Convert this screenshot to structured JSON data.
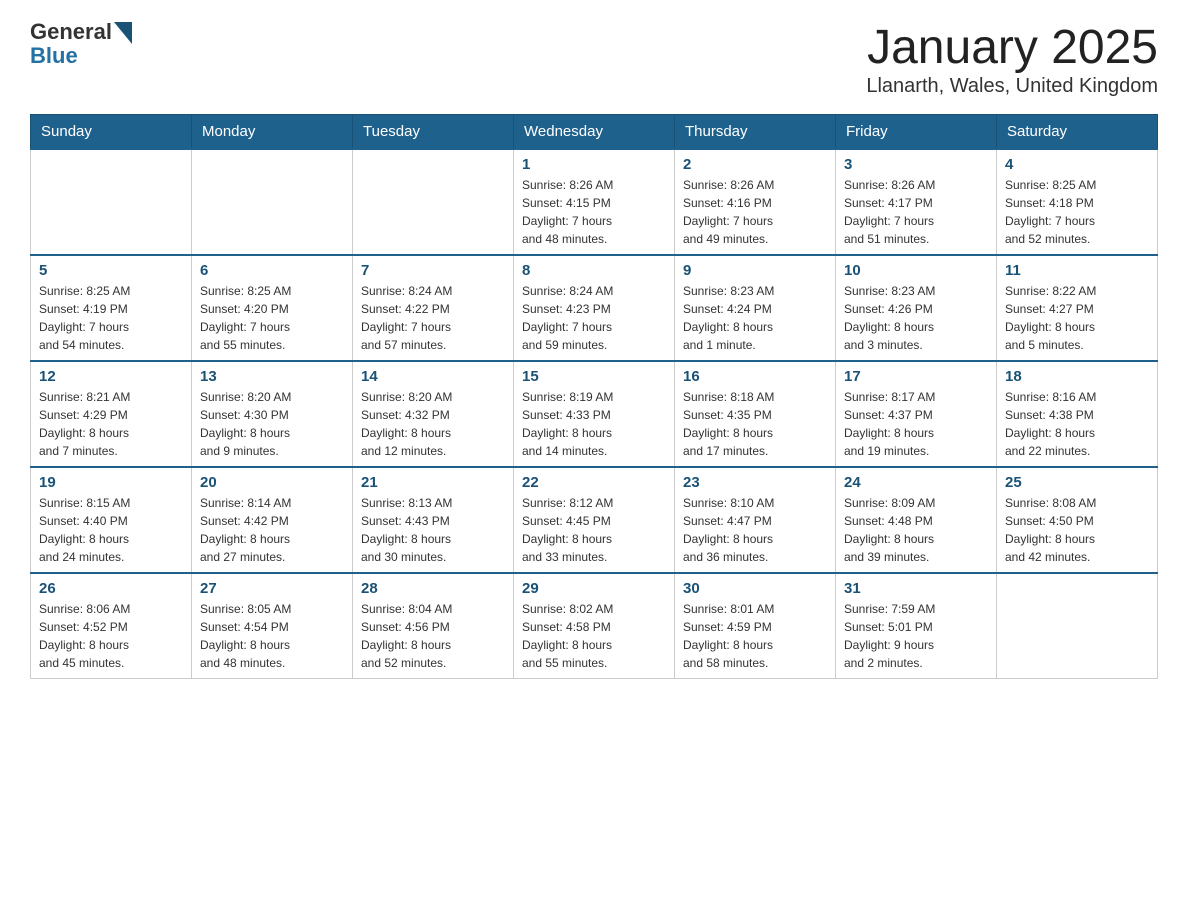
{
  "header": {
    "logo_general": "General",
    "logo_blue": "Blue",
    "month_title": "January 2025",
    "location": "Llanarth, Wales, United Kingdom"
  },
  "days_of_week": [
    "Sunday",
    "Monday",
    "Tuesday",
    "Wednesday",
    "Thursday",
    "Friday",
    "Saturday"
  ],
  "weeks": [
    [
      {
        "day": "",
        "info": ""
      },
      {
        "day": "",
        "info": ""
      },
      {
        "day": "",
        "info": ""
      },
      {
        "day": "1",
        "info": "Sunrise: 8:26 AM\nSunset: 4:15 PM\nDaylight: 7 hours\nand 48 minutes."
      },
      {
        "day": "2",
        "info": "Sunrise: 8:26 AM\nSunset: 4:16 PM\nDaylight: 7 hours\nand 49 minutes."
      },
      {
        "day": "3",
        "info": "Sunrise: 8:26 AM\nSunset: 4:17 PM\nDaylight: 7 hours\nand 51 minutes."
      },
      {
        "day": "4",
        "info": "Sunrise: 8:25 AM\nSunset: 4:18 PM\nDaylight: 7 hours\nand 52 minutes."
      }
    ],
    [
      {
        "day": "5",
        "info": "Sunrise: 8:25 AM\nSunset: 4:19 PM\nDaylight: 7 hours\nand 54 minutes."
      },
      {
        "day": "6",
        "info": "Sunrise: 8:25 AM\nSunset: 4:20 PM\nDaylight: 7 hours\nand 55 minutes."
      },
      {
        "day": "7",
        "info": "Sunrise: 8:24 AM\nSunset: 4:22 PM\nDaylight: 7 hours\nand 57 minutes."
      },
      {
        "day": "8",
        "info": "Sunrise: 8:24 AM\nSunset: 4:23 PM\nDaylight: 7 hours\nand 59 minutes."
      },
      {
        "day": "9",
        "info": "Sunrise: 8:23 AM\nSunset: 4:24 PM\nDaylight: 8 hours\nand 1 minute."
      },
      {
        "day": "10",
        "info": "Sunrise: 8:23 AM\nSunset: 4:26 PM\nDaylight: 8 hours\nand 3 minutes."
      },
      {
        "day": "11",
        "info": "Sunrise: 8:22 AM\nSunset: 4:27 PM\nDaylight: 8 hours\nand 5 minutes."
      }
    ],
    [
      {
        "day": "12",
        "info": "Sunrise: 8:21 AM\nSunset: 4:29 PM\nDaylight: 8 hours\nand 7 minutes."
      },
      {
        "day": "13",
        "info": "Sunrise: 8:20 AM\nSunset: 4:30 PM\nDaylight: 8 hours\nand 9 minutes."
      },
      {
        "day": "14",
        "info": "Sunrise: 8:20 AM\nSunset: 4:32 PM\nDaylight: 8 hours\nand 12 minutes."
      },
      {
        "day": "15",
        "info": "Sunrise: 8:19 AM\nSunset: 4:33 PM\nDaylight: 8 hours\nand 14 minutes."
      },
      {
        "day": "16",
        "info": "Sunrise: 8:18 AM\nSunset: 4:35 PM\nDaylight: 8 hours\nand 17 minutes."
      },
      {
        "day": "17",
        "info": "Sunrise: 8:17 AM\nSunset: 4:37 PM\nDaylight: 8 hours\nand 19 minutes."
      },
      {
        "day": "18",
        "info": "Sunrise: 8:16 AM\nSunset: 4:38 PM\nDaylight: 8 hours\nand 22 minutes."
      }
    ],
    [
      {
        "day": "19",
        "info": "Sunrise: 8:15 AM\nSunset: 4:40 PM\nDaylight: 8 hours\nand 24 minutes."
      },
      {
        "day": "20",
        "info": "Sunrise: 8:14 AM\nSunset: 4:42 PM\nDaylight: 8 hours\nand 27 minutes."
      },
      {
        "day": "21",
        "info": "Sunrise: 8:13 AM\nSunset: 4:43 PM\nDaylight: 8 hours\nand 30 minutes."
      },
      {
        "day": "22",
        "info": "Sunrise: 8:12 AM\nSunset: 4:45 PM\nDaylight: 8 hours\nand 33 minutes."
      },
      {
        "day": "23",
        "info": "Sunrise: 8:10 AM\nSunset: 4:47 PM\nDaylight: 8 hours\nand 36 minutes."
      },
      {
        "day": "24",
        "info": "Sunrise: 8:09 AM\nSunset: 4:48 PM\nDaylight: 8 hours\nand 39 minutes."
      },
      {
        "day": "25",
        "info": "Sunrise: 8:08 AM\nSunset: 4:50 PM\nDaylight: 8 hours\nand 42 minutes."
      }
    ],
    [
      {
        "day": "26",
        "info": "Sunrise: 8:06 AM\nSunset: 4:52 PM\nDaylight: 8 hours\nand 45 minutes."
      },
      {
        "day": "27",
        "info": "Sunrise: 8:05 AM\nSunset: 4:54 PM\nDaylight: 8 hours\nand 48 minutes."
      },
      {
        "day": "28",
        "info": "Sunrise: 8:04 AM\nSunset: 4:56 PM\nDaylight: 8 hours\nand 52 minutes."
      },
      {
        "day": "29",
        "info": "Sunrise: 8:02 AM\nSunset: 4:58 PM\nDaylight: 8 hours\nand 55 minutes."
      },
      {
        "day": "30",
        "info": "Sunrise: 8:01 AM\nSunset: 4:59 PM\nDaylight: 8 hours\nand 58 minutes."
      },
      {
        "day": "31",
        "info": "Sunrise: 7:59 AM\nSunset: 5:01 PM\nDaylight: 9 hours\nand 2 minutes."
      },
      {
        "day": "",
        "info": ""
      }
    ]
  ]
}
